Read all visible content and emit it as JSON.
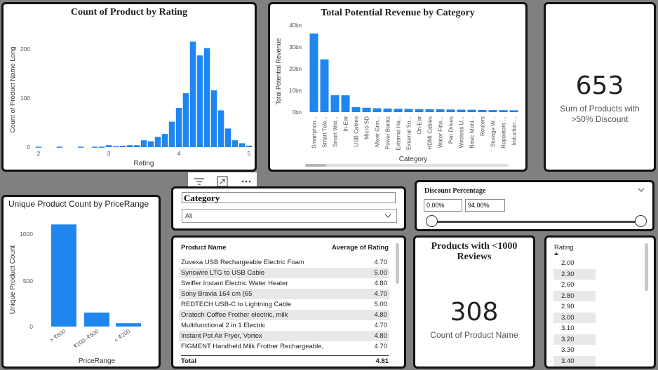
{
  "rating_hist": {
    "title": "Count of Product by Rating",
    "ylabel": "Count of Product Name Long",
    "xlabel": "Rating",
    "yticks": [
      "0",
      "100",
      "200"
    ],
    "xticks": [
      "2",
      "3",
      "4",
      "5"
    ]
  },
  "revenue_chart": {
    "title": "Total Potential Revenue by Category",
    "ylabel": "Total Potential Revenue",
    "xlabel": "Category",
    "yticks": [
      "0bn",
      "10bn",
      "20bn",
      "30bn",
      "40bn"
    ],
    "categories": [
      "Smartphon...",
      "Smart Tele...",
      "Smart Wat...",
      "In-Ear",
      "USB Cables",
      "Micro SD",
      "Mixer Grin...",
      "Power Banks",
      "External Ha...",
      "External So...",
      "On-Ear",
      "HDMI Cables",
      "Water Filte...",
      "Pen Drives",
      "Wireless U...",
      "Basic Mobi...",
      "Routers",
      "Storage W...",
      "Repeaters ...",
      "Induction ..."
    ]
  },
  "kpi_discount": {
    "value": "653",
    "label": "Sum of Products with >50% Discount"
  },
  "price_chart": {
    "title": "Unique Product Count by PriceRange",
    "ylabel": "Unique Product Count",
    "xlabel": "PriceRange",
    "yticks": [
      "0",
      "500",
      "1000"
    ],
    "categories": [
      "> ₹500",
      "₹200–₹500",
      "< ₹200"
    ]
  },
  "category_slicer": {
    "title": "Category",
    "selected": "All"
  },
  "discount_slicer": {
    "title": "Discount Percentage",
    "min": "0.00%",
    "max": "94.00%"
  },
  "product_table": {
    "col1": "Product Name",
    "col2": "Average of Rating",
    "rows": [
      {
        "name": "Zuvexa USB Rechargeable Electric Foam",
        "rating": "4.70"
      },
      {
        "name": "Syncwire LTG to USB Cable",
        "rating": "5.00"
      },
      {
        "name": "Swiffer Instant Electric Water Heater",
        "rating": "4.80"
      },
      {
        "name": "Sony Bravia 164 cm (65",
        "rating": "4.70"
      },
      {
        "name": "REDTECH USB-C to Lightning Cable",
        "rating": "5.00"
      },
      {
        "name": "Oratech Coffee Frother electric, milk",
        "rating": "4.80"
      },
      {
        "name": "Multifunctional 2 in 1 Electric",
        "rating": "4.70"
      },
      {
        "name": "Instant Pot Air Fryer, Vortex",
        "rating": "4.80"
      },
      {
        "name": "FIGMENT Handheld Milk Frother Rechargeable,",
        "rating": "4.70"
      }
    ],
    "total_label": "Total",
    "total_value": "4.81"
  },
  "kpi_reviews": {
    "title": "Products with <1000 Reviews",
    "value": "308",
    "label": "Count of Product Name"
  },
  "rating_list": {
    "header": "Rating",
    "values": [
      "2.00",
      "2.30",
      "2.60",
      "2.80",
      "2.90",
      "3.00",
      "3.10",
      "3.20",
      "3.30",
      "3.40"
    ]
  },
  "chart_data": [
    {
      "type": "bar",
      "title": "Count of Product by Rating",
      "xlabel": "Rating",
      "ylabel": "Count of Product Name Long",
      "x": [
        2.0,
        2.3,
        2.6,
        2.8,
        2.9,
        3.0,
        3.1,
        3.2,
        3.3,
        3.4,
        3.5,
        3.6,
        3.7,
        3.8,
        3.9,
        4.0,
        4.1,
        4.2,
        4.3,
        4.4,
        4.5,
        4.6,
        4.7,
        4.8,
        4.9,
        5.0
      ],
      "values": [
        1,
        1,
        1,
        1,
        1,
        4,
        2,
        3,
        4,
        4,
        14,
        12,
        21,
        27,
        52,
        80,
        110,
        215,
        187,
        202,
        116,
        75,
        38,
        14,
        8,
        3
      ],
      "xlim": [
        1.95,
        5.05
      ],
      "ylim": [
        0,
        250
      ]
    },
    {
      "type": "bar",
      "title": "Total Potential Revenue by Category",
      "xlabel": "Category",
      "ylabel": "Total Potential Revenue",
      "categories": [
        "Smartphon...",
        "Smart Tele...",
        "Smart Wat...",
        "In-Ear",
        "USB Cables",
        "Micro SD",
        "Mixer Grin...",
        "Power Banks",
        "External Ha...",
        "External So...",
        "On-Ear",
        "HDMI Cables",
        "Water Filte...",
        "Pen Drives",
        "Wireless U...",
        "Basic Mobi...",
        "Routers",
        "Storage W...",
        "Repeaters ...",
        "Induction ..."
      ],
      "values": [
        36.5,
        24.5,
        7.9,
        7.8,
        2.3,
        2.0,
        1.8,
        1.7,
        1.6,
        1.5,
        1.4,
        1.35,
        1.3,
        1.2,
        1.15,
        1.1,
        1.0,
        0.95,
        0.9,
        0.85
      ],
      "ylim": [
        0,
        40
      ]
    },
    {
      "type": "bar",
      "title": "Unique Product Count by PriceRange",
      "xlabel": "PriceRange",
      "ylabel": "Unique Product Count",
      "categories": [
        "> ₹500",
        "₹200–₹500",
        "< ₹200"
      ],
      "values": [
        1060,
        145,
        35
      ],
      "ylim": [
        0,
        1200
      ]
    }
  ],
  "colors": {
    "bar": "#1f86f0",
    "accent": "#111111"
  },
  "icons": [
    "filter-icon",
    "focus-mode-icon",
    "more-options-icon",
    "chevron-down-icon",
    "sort-arrow-icon"
  ]
}
